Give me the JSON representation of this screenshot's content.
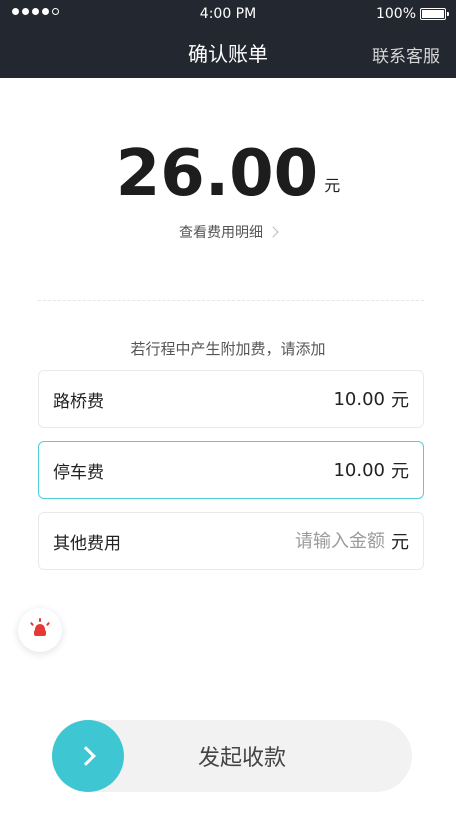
{
  "status_bar": {
    "time": "4:00 PM",
    "battery": "100%"
  },
  "nav": {
    "title": "确认账单",
    "right": "联系客服"
  },
  "amount": {
    "value": "26.00",
    "unit": "元"
  },
  "details_link": "查看费用明细",
  "extra_tip": "若行程中产生附加费，请添加",
  "fees": [
    {
      "label": "路桥费",
      "value": "10.00",
      "unit": "元"
    },
    {
      "label": "停车费",
      "value": "10.00",
      "unit": "元"
    },
    {
      "label": "其他费用",
      "placeholder": "请输入金额",
      "unit": "元"
    }
  ],
  "collect_label": "发起收款",
  "icons": {
    "chevron_details": "chevron-right-icon",
    "sos": "siren-icon",
    "knob": "arrow-right-icon",
    "signal": "signal-dots-icon",
    "battery": "battery-icon"
  },
  "colors": {
    "header_bg": "#23272f",
    "accent": "#3ec6d3",
    "active_border": "#4fd0d8",
    "sos_red": "#e53935"
  }
}
